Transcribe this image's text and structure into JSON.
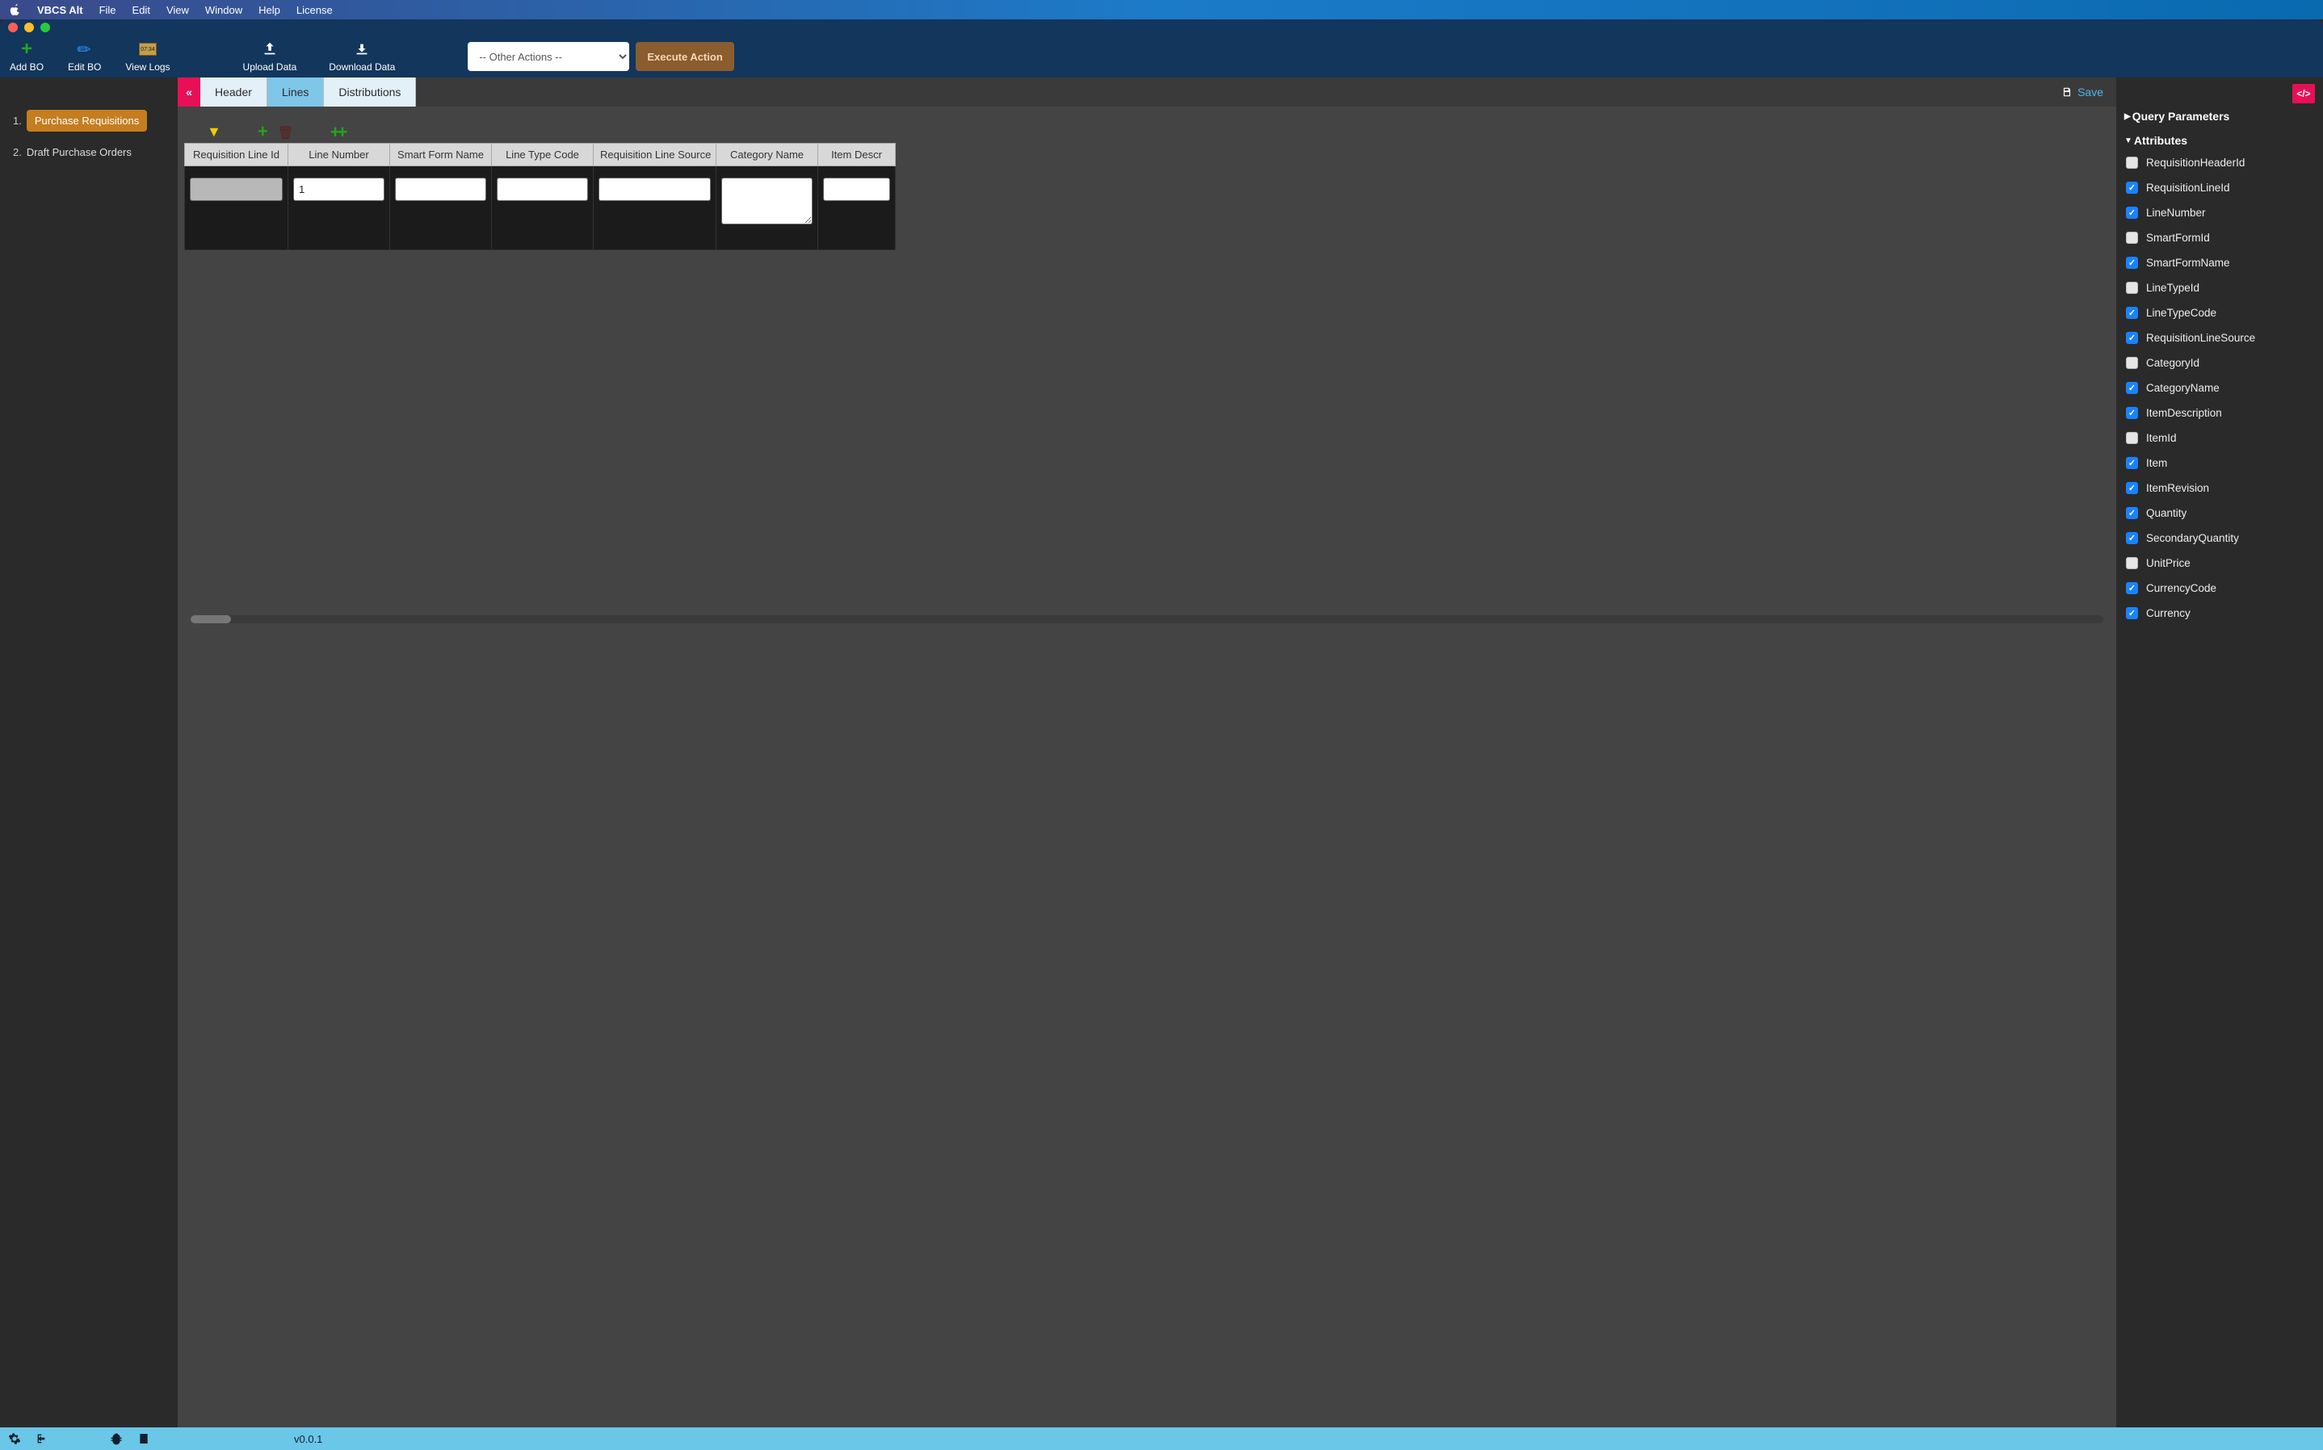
{
  "menubar": {
    "app_title": "VBCS Alt",
    "items": [
      "File",
      "Edit",
      "View",
      "Window",
      "Help",
      "License"
    ]
  },
  "toolbar": {
    "add_bo": "Add BO",
    "edit_bo": "Edit BO",
    "view_logs": "View Logs",
    "upload_data": "Upload Data",
    "download_data": "Download Data",
    "actions_select": "-- Other Actions --",
    "execute": "Execute Action"
  },
  "sidebar": {
    "items": [
      {
        "num": "1.",
        "name": "Purchase Requisitions",
        "active": true
      },
      {
        "num": "2.",
        "name": "Draft Purchase Orders",
        "active": false
      }
    ]
  },
  "tabs": {
    "items": [
      {
        "label": "Header",
        "active": false
      },
      {
        "label": "Lines",
        "active": true
      },
      {
        "label": "Distributions",
        "active": false
      }
    ],
    "save": "Save"
  },
  "grid": {
    "columns": [
      "Requisition Line Id",
      "Line Number",
      "Smart Form Name",
      "Line Type Code",
      "Requisition Line Source",
      "Category Name",
      "Item Descr"
    ],
    "rows": [
      {
        "requisition_line_id": "",
        "line_number": "1",
        "smart_form_name": "",
        "line_type_code": "",
        "requisition_line_source": "",
        "category_name": "",
        "item_descr": ""
      }
    ]
  },
  "right_panel": {
    "query_params": "Query Parameters",
    "attributes": "Attributes",
    "attrs": [
      {
        "name": "RequisitionHeaderId",
        "checked": false
      },
      {
        "name": "RequisitionLineId",
        "checked": true
      },
      {
        "name": "LineNumber",
        "checked": true
      },
      {
        "name": "SmartFormId",
        "checked": false
      },
      {
        "name": "SmartFormName",
        "checked": true
      },
      {
        "name": "LineTypeId",
        "checked": false
      },
      {
        "name": "LineTypeCode",
        "checked": true
      },
      {
        "name": "RequisitionLineSource",
        "checked": true
      },
      {
        "name": "CategoryId",
        "checked": false
      },
      {
        "name": "CategoryName",
        "checked": true
      },
      {
        "name": "ItemDescription",
        "checked": true
      },
      {
        "name": "ItemId",
        "checked": false
      },
      {
        "name": "Item",
        "checked": true
      },
      {
        "name": "ItemRevision",
        "checked": true
      },
      {
        "name": "Quantity",
        "checked": true
      },
      {
        "name": "SecondaryQuantity",
        "checked": true
      },
      {
        "name": "UnitPrice",
        "checked": false
      },
      {
        "name": "CurrencyCode",
        "checked": true
      },
      {
        "name": "Currency",
        "checked": true
      }
    ]
  },
  "statusbar": {
    "version": "v0.0.1"
  }
}
